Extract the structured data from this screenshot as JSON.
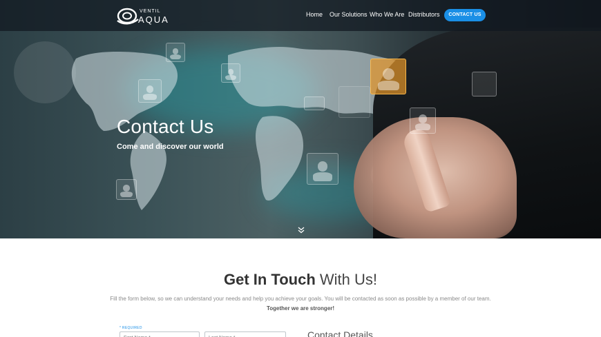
{
  "brand": {
    "logo_top": "VENTIL",
    "logo_main": "AQUA"
  },
  "nav": {
    "items": [
      {
        "label": "Home"
      },
      {
        "label": "Our Solutions"
      },
      {
        "label": "Who We Are"
      },
      {
        "label": "Distributors"
      }
    ],
    "cta_label": "CONTACT US"
  },
  "hero": {
    "title": "Contact Us",
    "subtitle": "Come and discover our world",
    "scroll_icon": "double-chevron-down-icon"
  },
  "section": {
    "title_bold": "Get In Touch",
    "title_light": "With Us!",
    "intro": "Fill the form below, so we can understand your needs and help you achieve your goals. You will be contacted as soon as possible by a member of our team.",
    "motto": "Together we are stronger!",
    "required_label": "* REQUIRED",
    "first_name_placeholder": "First Name *",
    "last_name_placeholder": "Last Name *",
    "contact_details_heading": "Contact Details"
  },
  "colors": {
    "accent": "#1a8fe6",
    "navbar": "#101820",
    "heading": "#333333"
  }
}
